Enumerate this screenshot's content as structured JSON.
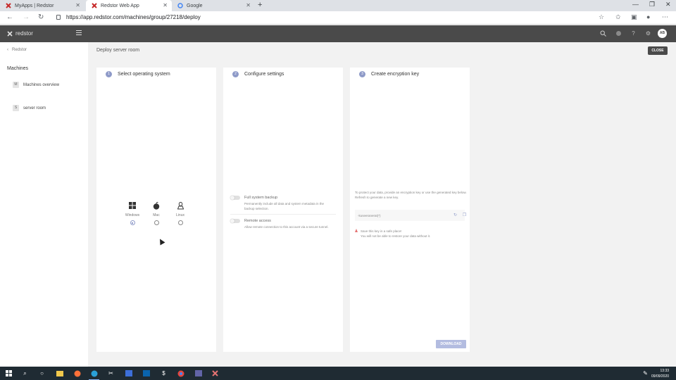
{
  "browser": {
    "tabs": [
      {
        "title": "MyApps | Redstor",
        "active": false
      },
      {
        "title": "Redstor Web App",
        "active": true
      },
      {
        "title": "Google",
        "active": false
      }
    ],
    "url": "https://app.redstor.com/machines/group/27218/deploy"
  },
  "app": {
    "brand": "redstor",
    "avatar_initials": "AB"
  },
  "sidebar": {
    "back_label": "Redstor",
    "section_title": "Machines",
    "items": [
      {
        "badge": "M",
        "label": "Machines overview"
      },
      {
        "badge": "S",
        "label": "server room"
      }
    ]
  },
  "main": {
    "page_title": "Deploy server room",
    "close_label": "CLOSE"
  },
  "steps": [
    {
      "number": "1",
      "title": "Select operating system"
    },
    {
      "number": "2",
      "title": "Configure settings"
    },
    {
      "number": "3",
      "title": "Create encryption key"
    }
  ],
  "os_options": [
    {
      "label": "Windows",
      "icon": "windows-icon",
      "selected": true
    },
    {
      "label": "Mac",
      "icon": "apple-icon",
      "selected": false
    },
    {
      "label": "Linux",
      "icon": "linux-icon",
      "selected": false
    }
  ],
  "settings": [
    {
      "title": "Full system backup",
      "description": "Permanently include all data and system metadata in the backup selection.",
      "enabled": false
    },
    {
      "title": "Remote access",
      "description": "Allow remote connection to this account via a secure tunnel.",
      "enabled": false
    }
  ],
  "encryption": {
    "intro": "To protect your data, provide an encryption key or use the generated key below.",
    "refresh_hint": "Refresh to generate a new key.",
    "key_value": "-kuseeranerat(*)",
    "warning_title": "Save this key in a safe place!",
    "warning_body": "You will not be able to restore your data without it.",
    "download_label": "DOWNLOAD"
  },
  "taskbar": {
    "time": "13:33",
    "date": "09/09/2020"
  },
  "colors": {
    "accent": "#8e9ac8",
    "header": "#4a4a4a",
    "taskbar": "#1f2b33"
  }
}
